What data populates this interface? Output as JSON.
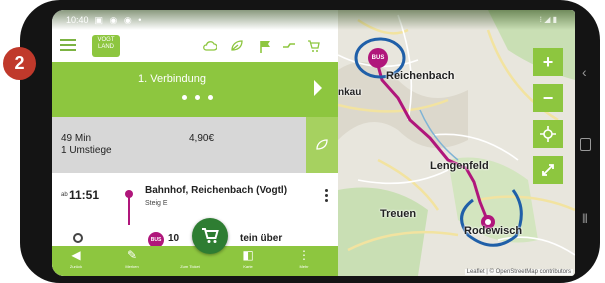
{
  "step_badge": "2",
  "status": {
    "time": "10:40",
    "icons": "▣ ◉ ◉ •",
    "right": "⁝ ◢ ▮"
  },
  "logo": {
    "line1": "VOGT",
    "line2": "LAND"
  },
  "connection": {
    "title": "1. Verbindung",
    "page_count": 3
  },
  "summary": {
    "duration": "49 Min",
    "transfers": "1 Umstiege",
    "price": "4,90€"
  },
  "departure": {
    "prefix": "ab",
    "time": "11:51",
    "stop": "Bahnhof, Reichenbach (Vogtl)",
    "platform": "Steig E"
  },
  "next_leg": {
    "line_badge": "BUS",
    "text_left": "10",
    "text_right": "tein über"
  },
  "bottom_nav": [
    {
      "icon": "back-arrow-icon",
      "label": "Zurück"
    },
    {
      "icon": "ticket-icon",
      "label": "Merken"
    },
    {
      "icon": "cart-icon",
      "label": "Zum Ticket"
    },
    {
      "icon": "map-icon",
      "label": "Karte"
    },
    {
      "icon": "more-icon",
      "label": "Mehr"
    }
  ],
  "map": {
    "labels": {
      "reichenbach": "Reichenbach",
      "lengenfeld": "Lengenfeld",
      "treuen": "Treuen",
      "rodewisch": "Rodewisch",
      "ankau": "nkau"
    },
    "bus_marker": "BUS",
    "attribution": "Leaflet | © OpenStreetMap contributors",
    "controls": [
      "zoom-in",
      "zoom-out",
      "locate",
      "fullscreen"
    ]
  },
  "colors": {
    "accent": "#8dc63f",
    "route": "#b0167b",
    "highlight_circle": "#1f5fa8",
    "badge": "#c0392b"
  }
}
